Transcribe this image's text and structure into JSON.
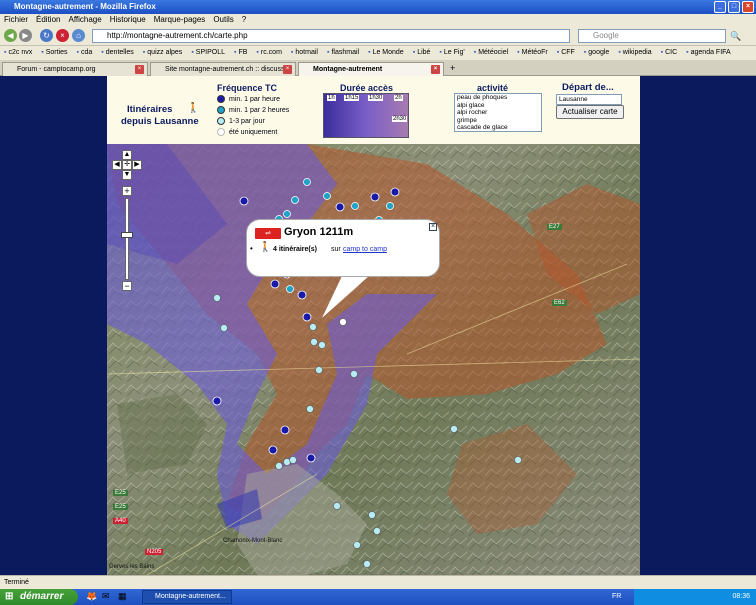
{
  "window": {
    "title": "Montagne-autrement - Mozilla Firefox"
  },
  "menu": [
    "Fichier",
    "Édition",
    "Affichage",
    "Historique",
    "Marque-pages",
    "Outils",
    "?"
  ],
  "nav": {
    "url": "http://montagne-autrement.ch/carte.php",
    "search_placeholder": "Google"
  },
  "bookmarks": [
    "c2c nvx",
    "Sorties",
    "cda",
    "dentelles",
    "quizz alpes",
    "SPIPOLL",
    "FB",
    "rc.com",
    "hotmail",
    "flashmail",
    "Le Monde",
    "Libé",
    "Le Fig'",
    "Météociel",
    "MétéoFr",
    "CFF",
    "google",
    "wikipedia",
    "CIC",
    "agenda FIFA"
  ],
  "tabs": [
    {
      "label": "Forum - camptocamp.org"
    },
    {
      "label": "Site montagne-autrement.ch :: discussi..."
    },
    {
      "label": "Montagne-autrement"
    }
  ],
  "panel": {
    "itin_title_1": "Itinéraires",
    "itin_title_2": "depuis Lausanne",
    "freq_title": "Fréquence TC",
    "freq_items": [
      {
        "label": "min. 1 par heure",
        "color": "#1a1aa8"
      },
      {
        "label": "min. 1 par 2 heures",
        "color": "#1fa3c8"
      },
      {
        "label": "1-3 par jour",
        "color": "#b8ecf4"
      },
      {
        "label": "été uniquement",
        "color": "#ffffff"
      }
    ],
    "duree_title": "Durée accès",
    "duree_labels": [
      "1h",
      "1h15",
      "1h30",
      "2h",
      "2h30"
    ],
    "activity_title": "activité",
    "activities": [
      "peau de phoques",
      "alpi glace",
      "alpi rocher",
      "grimpe",
      "cascade de glace"
    ],
    "depart_title": "Départ de...",
    "depart_value": "Lausanne",
    "update_label": "Actualiser carte"
  },
  "popup": {
    "title": "Gryon 1211m",
    "count": "4 itinéraire(s)",
    "sur": "sur",
    "link": "camp to camp"
  },
  "map_labels": [
    "E25",
    "E25",
    "A40",
    "N205",
    "Chamonix-Mont-Blanc",
    "E62",
    "E27",
    "Gerves les Bains"
  ],
  "status": "Terminé",
  "taskbar": {
    "start": "démarrer",
    "task": "Montagne-autrement...",
    "lang": "FR",
    "time": "08:36"
  },
  "colors": {
    "purple_zone": "#6a5cd8",
    "brown_zone": "#b4552c"
  }
}
